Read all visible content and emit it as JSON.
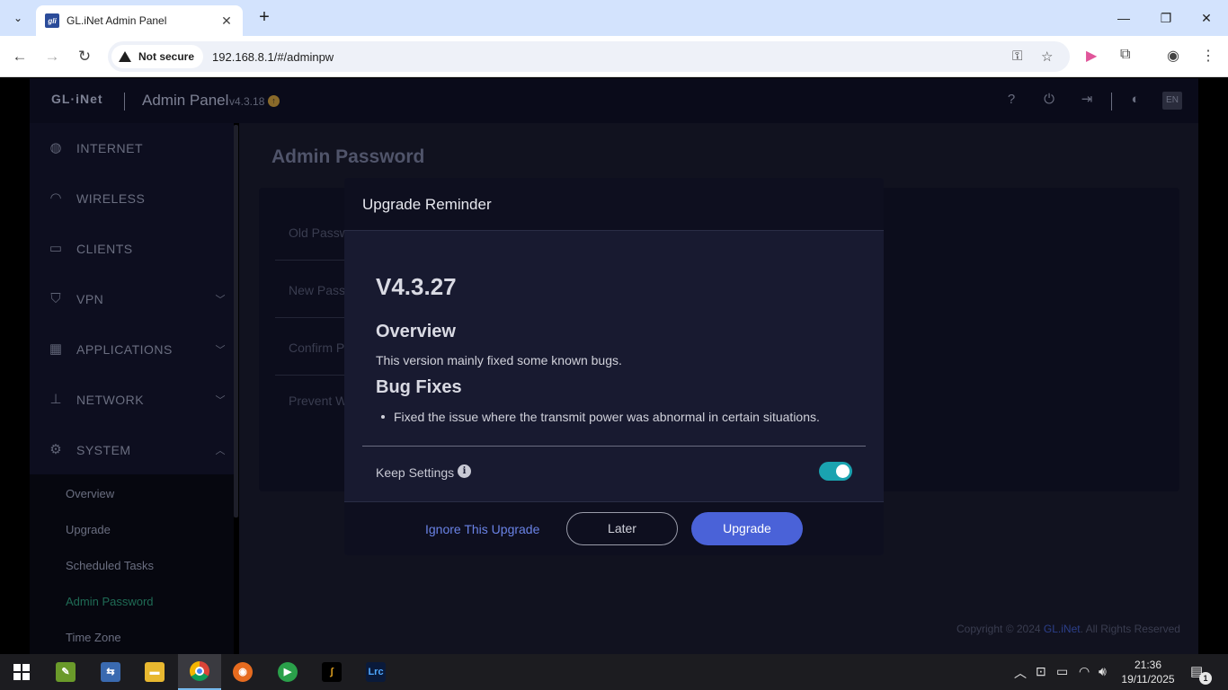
{
  "browser": {
    "tab_title": "GL.iNet Admin Panel",
    "tab_favicon_text": "gli",
    "security_label": "Not secure",
    "url": "192.168.8.1/#/adminpw"
  },
  "header": {
    "logo": "GL·iNet",
    "title": "Admin Panel",
    "version": "v4.3.18",
    "lang": "EN"
  },
  "sidebar": {
    "items": [
      {
        "label": "INTERNET",
        "icon": "globe-icon"
      },
      {
        "label": "WIRELESS",
        "icon": "wifi-icon"
      },
      {
        "label": "CLIENTS",
        "icon": "devices-icon"
      },
      {
        "label": "VPN",
        "icon": "shield-icon"
      },
      {
        "label": "APPLICATIONS",
        "icon": "apps-icon"
      },
      {
        "label": "NETWORK",
        "icon": "network-icon"
      },
      {
        "label": "SYSTEM",
        "icon": "gear-icon"
      }
    ],
    "system_sub": [
      "Overview",
      "Upgrade",
      "Scheduled Tasks",
      "Admin Password",
      "Time Zone"
    ]
  },
  "content": {
    "page_title": "Admin Password",
    "form_labels": [
      "Old Passw",
      "New Pass",
      "Confirm P",
      "Prevent W"
    ],
    "copyright_pre": "Copyright © 2024 ",
    "copyright_brand": "GL.iNet",
    "copyright_post": ". All Rights Reserved"
  },
  "modal": {
    "title": "Upgrade Reminder",
    "version": "V4.3.27",
    "overview_heading": "Overview",
    "overview_text": "This version mainly fixed some known bugs.",
    "bugfix_heading": "Bug Fixes",
    "bugfix_items": [
      "Fixed the issue where the transmit power was abnormal in certain situations."
    ],
    "keep_settings_label": "Keep Settings",
    "keep_settings_on": true,
    "ignore_label": "Ignore This Upgrade",
    "later_label": "Later",
    "upgrade_label": "Upgrade"
  },
  "taskbar": {
    "time": "21:36",
    "date": "19/11/2025",
    "notification_count": "1",
    "apps": [
      "start",
      "app-green",
      "app-network",
      "file-explorer",
      "chrome",
      "firefox",
      "app-green-circle",
      "app-curve",
      "lightroom"
    ],
    "lightroom_label": "Lrc"
  },
  "colors": {
    "accent_blue": "#4a62d8",
    "toggle_teal": "#1aa3b0",
    "active_green": "#1f6b55"
  }
}
